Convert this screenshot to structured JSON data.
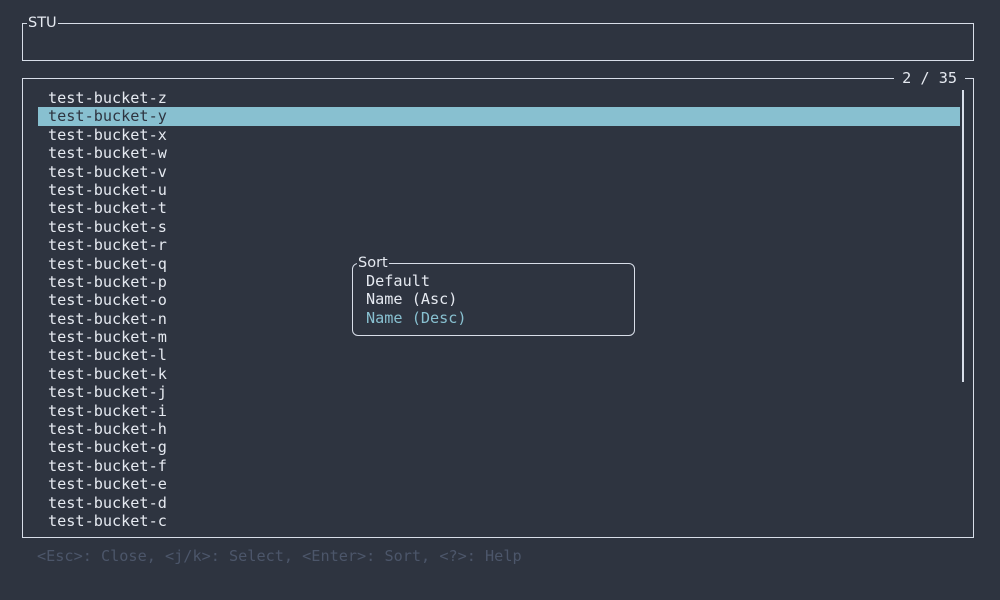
{
  "header": {
    "title": "STU"
  },
  "bucket_list": {
    "counter": "2 / 35",
    "selected_index": 1,
    "items": [
      "test-bucket-z",
      "test-bucket-y",
      "test-bucket-x",
      "test-bucket-w",
      "test-bucket-v",
      "test-bucket-u",
      "test-bucket-t",
      "test-bucket-s",
      "test-bucket-r",
      "test-bucket-q",
      "test-bucket-p",
      "test-bucket-o",
      "test-bucket-n",
      "test-bucket-m",
      "test-bucket-l",
      "test-bucket-k",
      "test-bucket-j",
      "test-bucket-i",
      "test-bucket-h",
      "test-bucket-g",
      "test-bucket-f",
      "test-bucket-e",
      "test-bucket-d",
      "test-bucket-c"
    ]
  },
  "sort_popup": {
    "title": "Sort",
    "selected_index": 2,
    "options": [
      "Default",
      "Name (Asc)",
      "Name (Desc)"
    ]
  },
  "help_bar": {
    "text": "<Esc>: Close, <j/k>: Select, <Enter>: Sort, <?>: Help"
  },
  "colors": {
    "background": "#2e3440",
    "foreground": "#e5e9f0",
    "accent": "#88c0d0",
    "muted": "#4c566a",
    "border": "#d8dee9"
  }
}
